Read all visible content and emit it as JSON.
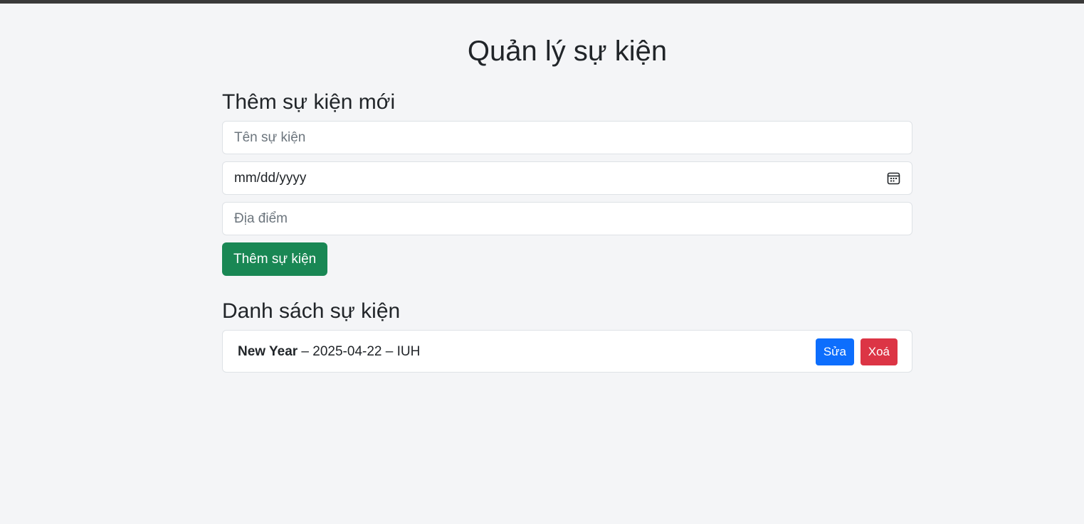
{
  "page": {
    "title": "Quản lý sự kiện"
  },
  "add_section": {
    "title": "Thêm sự kiện mới",
    "name_placeholder": "Tên sự kiện",
    "date_placeholder": "mm/dd/yyyy",
    "location_placeholder": "Địa điểm",
    "submit_label": "Thêm sự kiện"
  },
  "list_section": {
    "title": "Danh sách sự kiện",
    "events": [
      {
        "name": "New Year",
        "separator": " – ",
        "date": "2025-04-22",
        "location": "IUH",
        "edit_label": "Sửa",
        "delete_label": "Xoá"
      }
    ]
  },
  "colors": {
    "background": "#f4f5f7",
    "success": "#198754",
    "primary": "#0d6efd",
    "danger": "#dc3545"
  },
  "icons": {
    "date_picker": "calendar-icon"
  }
}
